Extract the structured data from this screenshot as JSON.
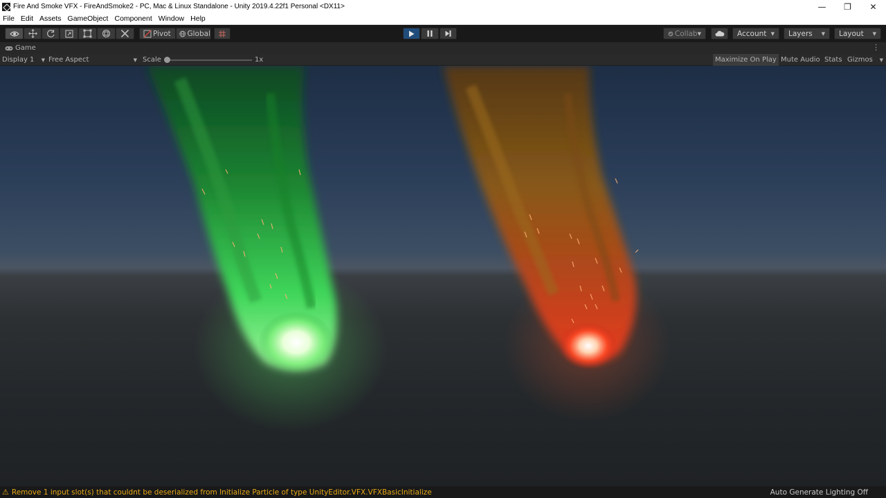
{
  "window": {
    "title": "Fire And Smoke VFX - FireAndSmoke2 - PC, Mac & Linux Standalone - Unity 2019.4.22f1 Personal <DX11>",
    "minimize_glyph": "—",
    "maximize_glyph": "❐",
    "close_glyph": "✕"
  },
  "menu": [
    "File",
    "Edit",
    "Assets",
    "GameObject",
    "Component",
    "Window",
    "Help"
  ],
  "toolbar": {
    "tools": [
      "view-tool",
      "move-tool",
      "rotate-tool",
      "scale-tool",
      "rect-tool",
      "transform-tool",
      "custom-tool"
    ],
    "pivot_label": "Pivot",
    "global_label": "Global",
    "collab_label": "Collab",
    "account_label": "Account",
    "layers_label": "Layers",
    "layout_label": "Layout",
    "play_accent": "#1f4c7a"
  },
  "game_tab": {
    "label": "Game"
  },
  "game_bar": {
    "display": "Display 1",
    "aspect": "Free Aspect",
    "scale_label": "Scale",
    "scale_value": "1x",
    "scale_level": 0,
    "maximize_on_play": "Maximize On Play",
    "mute_audio": "Mute Audio",
    "stats": "Stats",
    "gizmos": "Gizmos"
  },
  "status": {
    "message": "Remove 1 input slot(s) that couldnt be deserialized from Initialize Particle of type UnityEditor.VFX.VFXBasicInitialize",
    "right": "Auto Generate Lighting Off",
    "warning_color": "#e6a817"
  }
}
